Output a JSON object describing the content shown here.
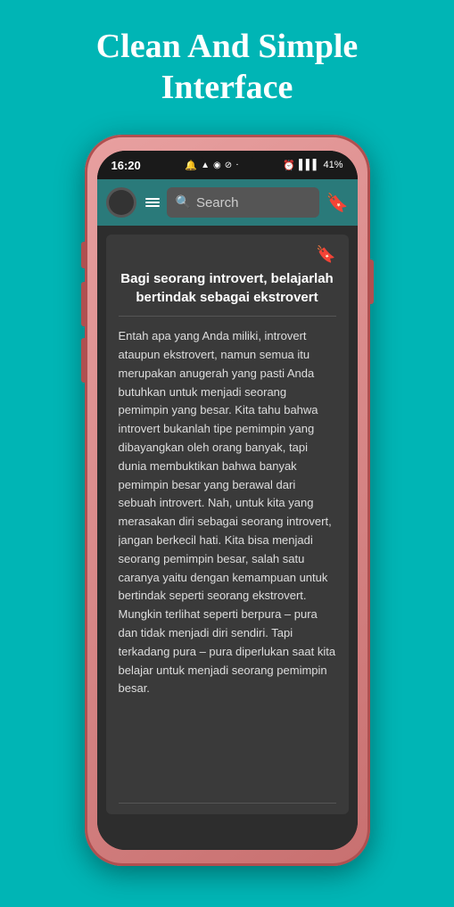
{
  "header": {
    "title": "Clean And Simple",
    "subtitle": "Interface"
  },
  "statusBar": {
    "time": "16:20",
    "battery": "41%",
    "icons": "🔔 ▲ ◉ ⊘ ·"
  },
  "topBar": {
    "searchPlaceholder": "Search",
    "searchIcon": "🔍",
    "bookmarkIcon": "🔖"
  },
  "card": {
    "bookmarkIcon": "🔖",
    "title": "Bagi seorang introvert, belajarlah bertindak sebagai ekstrovert",
    "body": "Entah apa yang Anda miliki, introvert ataupun ekstrovert, namun semua itu merupakan anugerah yang pasti Anda butuhkan untuk menjadi seorang pemimpin yang besar. Kita tahu bahwa introvert bukanlah tipe pemimpin yang dibayangkan oleh orang banyak, tapi dunia membuktikan bahwa banyak pemimpin besar yang berawal dari sebuah introvert. Nah, untuk kita yang merasakan diri sebagai seorang introvert, jangan berkecil hati. Kita bisa menjadi seorang pemimpin besar, salah satu caranya yaitu dengan kemampuan untuk bertindak seperti seorang ekstrovert. Mungkin terlihat seperti berpura – pura dan tidak menjadi diri sendiri. Tapi terkadang pura – pura diperlukan saat kita belajar untuk menjadi seorang pemimpin besar."
  }
}
